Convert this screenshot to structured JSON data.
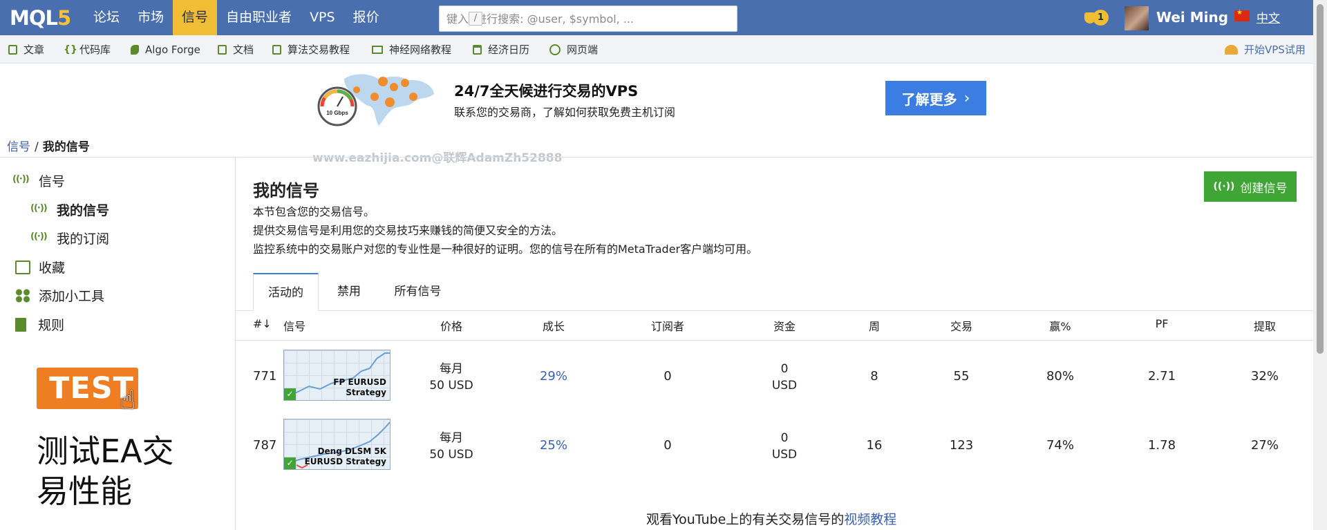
{
  "topbar": {
    "logo_main": "MQL",
    "logo_five": "5",
    "nav": [
      "论坛",
      "市场",
      "信号",
      "自由职业者",
      "VPS",
      "报价"
    ],
    "active_nav": "信号",
    "search_kbd": "/",
    "search_placeholder": "键入  进行搜索: @user, $symbol, ...",
    "notification_count": "1",
    "username": "Wei Ming",
    "language": "中文"
  },
  "toolbar": {
    "items": [
      "文章",
      "代码库",
      "Algo Forge",
      "文档",
      "算法交易教程",
      "神经网络教程",
      "经济日历",
      "网页端"
    ],
    "vps_trial": "开始VPS试用"
  },
  "banner": {
    "gauge_label": "10 Gbps",
    "title": "24/7全天候进行交易的VPS",
    "subtitle": "联系您的交易商，了解如何获取免费主机订阅",
    "button": "了解更多"
  },
  "breadcrumb": {
    "root": "信号",
    "separator": "/",
    "current": "我的信号"
  },
  "watermark": "www.eazhijia.com@联辉AdamZh52888",
  "sidebar": {
    "items": [
      "信号",
      "我的信号",
      "我的订阅",
      "收藏",
      "添加小工具",
      "规则"
    ],
    "test_badge": "TEST",
    "test_text": "测试EA交易性能"
  },
  "main": {
    "title": "我的信号",
    "desc": [
      "本节包含您的交易信号。",
      "提供交易信号是利用您的交易技巧来赚钱的简便又安全的方法。",
      "监控系统中的交易账户对您的专业性是一种很好的证明。您的信号在所有的MetaTrader客户端均可用。"
    ],
    "create_button": "创建信号",
    "tabs": [
      "活动的",
      "禁用",
      "所有信号"
    ],
    "active_tab": "活动的"
  },
  "table": {
    "columns": [
      "#↓",
      "信号",
      "价格",
      "成长",
      "订阅者",
      "资金",
      "周",
      "交易",
      "赢%",
      "PF",
      "提取"
    ],
    "rows": [
      {
        "id": "771",
        "name_line1": "FP EURUSD",
        "name_line2": "Strategy",
        "price_line1": "每月",
        "price_line2": "50 USD",
        "growth": "29%",
        "subscribers": "0",
        "funds_line1": "0",
        "funds_line2": "USD",
        "weeks": "8",
        "trades": "55",
        "win": "80%",
        "pf": "2.71",
        "drawdown": "32%"
      },
      {
        "id": "787",
        "name_line1": "Deng DLSM 5K",
        "name_line2": "EURUSD Strategy",
        "price_line1": "每月",
        "price_line2": "50 USD",
        "growth": "25%",
        "subscribers": "0",
        "funds_line1": "0",
        "funds_line2": "USD",
        "weeks": "16",
        "trades": "123",
        "win": "74%",
        "pf": "1.78",
        "drawdown": "27%"
      }
    ]
  },
  "footer": {
    "text": "观看YouTube上的有关交易信号的",
    "link": "视频教程"
  },
  "colors": {
    "topbar": "#4a6fae",
    "nav_active": "#f1bd34",
    "link": "#3a5fb0",
    "create_button": "#3fa535",
    "banner_button": "#3b7de0",
    "test_badge": "#ef7d22"
  }
}
